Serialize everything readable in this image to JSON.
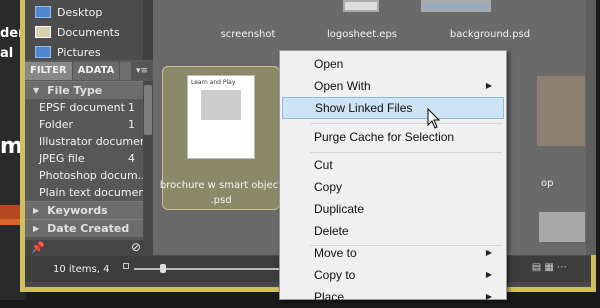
{
  "places": [
    {
      "label": "Desktop",
      "icon": "folder-icon"
    },
    {
      "label": "Documents",
      "icon": "document-folder-icon"
    },
    {
      "label": "Pictures",
      "icon": "folder-icon"
    }
  ],
  "tabs": {
    "filter": "FILTER",
    "metadata": "ADATA"
  },
  "filter": {
    "file_type": "File Type",
    "items": [
      {
        "label": "EPSF document",
        "count": "1"
      },
      {
        "label": "Folder",
        "count": "1"
      },
      {
        "label": "Illustrator document",
        "count": ""
      },
      {
        "label": "JPEG file",
        "count": "4"
      },
      {
        "label": "Photoshop docum...",
        "count": ""
      },
      {
        "label": "Plain text document",
        "count": ""
      }
    ],
    "keywords": "Keywords",
    "date_created": "Date Created"
  },
  "thumbs": {
    "screenshot": "screenshot",
    "logosheet": "logosheet.eps",
    "background": "background.psd",
    "brochure_line1": "brochure w smart object",
    "brochure_line2": ".psd",
    "brochure_title": "Learn and Play"
  },
  "status": "10 items, 4",
  "bg_text": {
    "t1": "der",
    "t2": "al",
    "t3": "m"
  },
  "menu": {
    "items": [
      {
        "label": "Open",
        "sub": false
      },
      {
        "label": "Open With",
        "sub": true
      },
      {
        "label": "Show Linked Files",
        "sub": false,
        "highlight": true
      },
      {
        "label": "Purge Cache for Selection",
        "sub": false
      },
      {
        "label": "Cut",
        "sub": false
      },
      {
        "label": "Copy",
        "sub": false
      },
      {
        "label": "Duplicate",
        "sub": false
      },
      {
        "label": "Delete",
        "sub": false
      },
      {
        "label": "Move to",
        "sub": true
      },
      {
        "label": "Copy to",
        "sub": true
      },
      {
        "label": "Place",
        "sub": true
      }
    ]
  },
  "colors": {
    "frame": "#cfbf5e",
    "highlight": "#cde4f7",
    "orange": "#b5481f"
  }
}
